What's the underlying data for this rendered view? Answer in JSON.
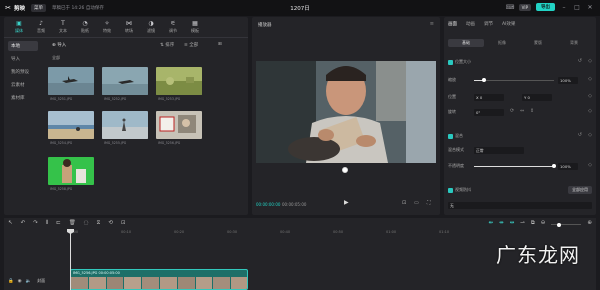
{
  "titlebar": {
    "app_name": "剪映",
    "menu_label": "菜单",
    "autosave": "草稿已于 14:26 自动保存",
    "project_title": "1207日",
    "vip_label": "VIP",
    "export_label": "导出"
  },
  "toolbar": {
    "items": [
      {
        "label": "媒体",
        "icon": "media-icon"
      },
      {
        "label": "音频",
        "icon": "audio-icon"
      },
      {
        "label": "文本",
        "icon": "text-icon"
      },
      {
        "label": "贴纸",
        "icon": "sticker-icon"
      },
      {
        "label": "特效",
        "icon": "effects-icon"
      },
      {
        "label": "转场",
        "icon": "transition-icon"
      },
      {
        "label": "滤镜",
        "icon": "filter-icon"
      },
      {
        "label": "调节",
        "icon": "adjust-icon"
      },
      {
        "label": "模板",
        "icon": "template-icon"
      }
    ],
    "active_index": 0
  },
  "media": {
    "nav": [
      "本地",
      "导入",
      "我的预设",
      "云素材",
      "素材库"
    ],
    "active_nav": 0,
    "import_label": "导入",
    "sort_label": "排序",
    "all_label": "全部",
    "section": "全部",
    "items": [
      {
        "caption": "IMG_5251.JPG"
      },
      {
        "caption": "IMG_5252.JPG"
      },
      {
        "caption": "IMG_5253.JPG"
      },
      {
        "caption": "IMG_5254.JPG"
      },
      {
        "caption": "IMG_5255.JPG"
      },
      {
        "caption": "IMG_5256.JPG"
      },
      {
        "caption": "IMG_5258.JPG"
      }
    ]
  },
  "player": {
    "title": "播放器",
    "current_time": "00:00:00:00",
    "total_time": "00:00:05:00"
  },
  "properties": {
    "tabs": [
      "画面",
      "动画",
      "调节",
      "AI效果"
    ],
    "active_tab": 0,
    "subtabs": [
      "基础",
      "抠像",
      "蒙版",
      "背景"
    ],
    "active_subtab": 0,
    "scale_section": "位置大小",
    "scale_label": "缩放",
    "scale_value": "100%",
    "scale_fraction": 0.12,
    "position_label": "位置",
    "pos_x": "0",
    "pos_y": "0",
    "rotate_label": "旋转",
    "rotate_value": "0°",
    "blend_section": "混合",
    "blend_mode_label": "混合模式",
    "blend_mode_value": "正常",
    "opacity_label": "不透明度",
    "opacity_value": "100%",
    "opacity_fraction": 1.0,
    "stabilize_section": "视频防抖",
    "apply_all_label": "全部应用",
    "stabilize_value": "无"
  },
  "timeline": {
    "ruler": [
      "00:00",
      "00:10",
      "00:20",
      "00:30",
      "00:40",
      "00:50",
      "01:00",
      "01:10"
    ],
    "cover_label": "封面",
    "clip_name": "IMG_5256.JPG  00:00:05:00"
  },
  "watermark": "广东龙网"
}
